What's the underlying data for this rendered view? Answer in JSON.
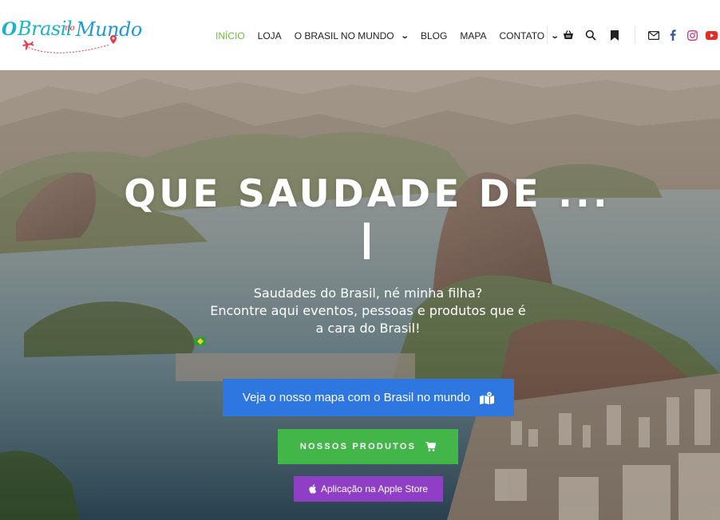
{
  "header": {
    "logo": {
      "o": "O",
      "brasil": "Brasil",
      "no": "no",
      "mundo": "Mundo"
    },
    "nav": [
      {
        "label": "INÍCIO",
        "active": true
      },
      {
        "label": "LOJA"
      },
      {
        "label": "O BRASIL NO MUNDO",
        "dropdown": true
      },
      {
        "label": "BLOG"
      },
      {
        "label": "MAPA"
      },
      {
        "label": "CONTATO",
        "dropdown": true
      }
    ],
    "icons": [
      "basket-icon",
      "search-icon",
      "bookmark-icon",
      "mail-icon",
      "facebook-icon",
      "instagram-icon",
      "youtube-icon"
    ],
    "colors": {
      "active": "#6bbf3a",
      "facebook": "#3b5998",
      "instagram": "#c13584",
      "youtube": "#e52d27"
    }
  },
  "hero": {
    "title": "QUE SAUDADE DE ...",
    "subtitle_lines": [
      "Saudades do Brasil, né minha filha?",
      "Encontre aqui eventos, pessoas e produtos que é",
      "a cara do Brasil!"
    ],
    "buttons": {
      "map": "Veja o nosso mapa com o Brasil no mundo",
      "products": "NOSSOS PRODUTOS",
      "apple": "Aplicação na Apple Store"
    },
    "colors": {
      "map": "#2e76e0",
      "products": "#43b649",
      "apple": "#8f3fc5"
    }
  }
}
